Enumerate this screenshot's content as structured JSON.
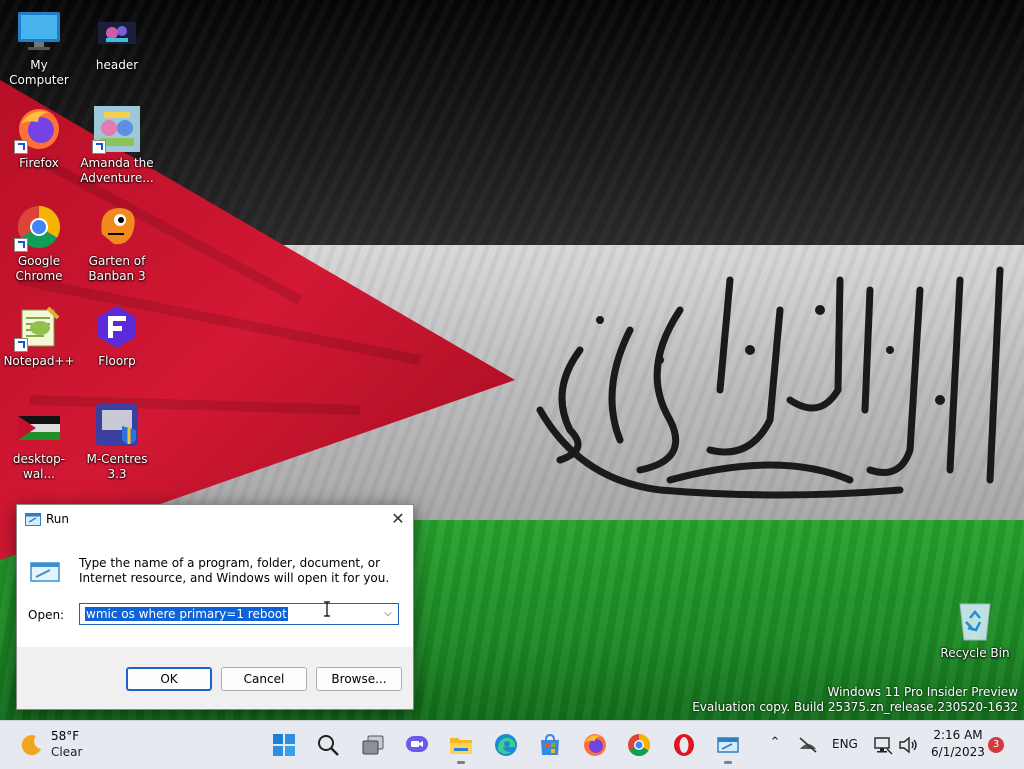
{
  "desktop": {
    "icons": [
      {
        "label": "My Computer",
        "icon": "monitor-icon"
      },
      {
        "label": "header",
        "icon": "image-icon"
      },
      {
        "label": "Firefox",
        "icon": "firefox-icon"
      },
      {
        "label": "Amanda the Adventure...",
        "icon": "game-icon"
      },
      {
        "label": "Google Chrome",
        "icon": "chrome-icon"
      },
      {
        "label": "Garten of Banban 3",
        "icon": "game-icon"
      },
      {
        "label": "Notepad++",
        "icon": "notepadpp-icon"
      },
      {
        "label": "Floorp",
        "icon": "floorp-icon"
      },
      {
        "label": "desktop-wal...",
        "icon": "image-icon"
      },
      {
        "label": "M-Centres 3.3",
        "icon": "m-centres-icon"
      },
      {
        "label": "Recycle Bin",
        "icon": "recycle-bin-icon"
      }
    ],
    "watermark": {
      "line1": "Windows 11 Pro Insider Preview",
      "line2": "Evaluation copy. Build 25375.zn_release.230520-1632"
    }
  },
  "run_dialog": {
    "title": "Run",
    "close_glyph": "✕",
    "description": "Type the name of a program, folder, document, or Internet resource, and Windows will open it for you.",
    "open_label": "Open:",
    "input_value": "wmic os where primary=1 reboot",
    "ok_label": "OK",
    "cancel_label": "Cancel",
    "browse_label": "Browse..."
  },
  "taskbar": {
    "weather": {
      "temp": "58°F",
      "condition": "Clear",
      "icon": "moon-icon"
    },
    "pinned": [
      "start-icon",
      "search-icon",
      "task-view-icon",
      "meet-chat-icon",
      "file-explorer-icon",
      "edge-icon",
      "store-icon",
      "firefox-icon",
      "chrome-icon",
      "opera-icon",
      "run-icon"
    ],
    "tray": {
      "language": "ENG",
      "time": "2:16 AM",
      "date": "6/1/2023",
      "notification_count": "3"
    }
  },
  "colors": {
    "flag_red": "#c8102e",
    "flag_green": "#1f8f28",
    "selection": "#0f63d6",
    "taskbar_bg": "#e6e9ef"
  }
}
